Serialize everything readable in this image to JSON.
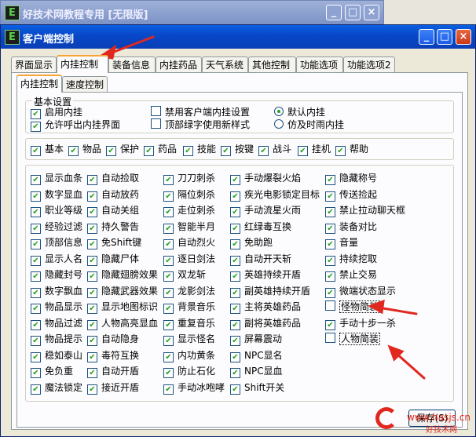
{
  "background_window": {
    "title": "好技术网教程专用 [无限版]"
  },
  "main_window": {
    "title": "客户端控制"
  },
  "title_buttons": {
    "minimize": "_",
    "maximize": "□",
    "close": "×"
  },
  "app_icon_letter": "E",
  "tabs": [
    "界面显示",
    "内挂控制",
    "装备信息",
    "内挂药品",
    "天气系统",
    "其他控制",
    "功能选项",
    "功能选项2"
  ],
  "subtabs": [
    "内挂控制",
    "速度控制"
  ],
  "basic_settings": {
    "title": "基本设置",
    "options": [
      {
        "label": "启用内挂",
        "type": "checkbox",
        "checked": true
      },
      {
        "label": "禁用客户端内挂设置",
        "type": "checkbox",
        "checked": false
      },
      {
        "label": "默认内挂",
        "type": "radio",
        "checked": true
      },
      {
        "label": "允许呼出内挂界面",
        "type": "checkbox",
        "checked": true
      },
      {
        "label": "顶部绿字使用新样式",
        "type": "checkbox",
        "checked": false
      },
      {
        "label": "仿及时雨内挂",
        "type": "radio",
        "checked": false
      }
    ]
  },
  "categories": [
    "基本",
    "物品",
    "保护",
    "药品",
    "技能",
    "按键",
    "战斗",
    "挂机",
    "帮助"
  ],
  "features": {
    "col1": [
      "显示血条",
      "数字显血",
      "职业等级",
      "经验过滤",
      "顶部信息",
      "显示人名",
      "隐藏封号",
      "数字飘血",
      "物品显示",
      "物品过滤",
      "物品提示",
      "稳如泰山",
      "免负重",
      "魔法锁定"
    ],
    "col2": [
      "自动捡取",
      "自动放药",
      "自动关组",
      "持久警告",
      "免Shift键",
      "隐藏尸体",
      "隐藏翅膀效果",
      "隐藏武器效果",
      "显示地图标识",
      "人物高亮显血",
      "自动隐身",
      "毒符互换",
      "自动开盾",
      "接近开盾"
    ],
    "col3": [
      "刀刀刺杀",
      "隔位刺杀",
      "走位刺杀",
      "智能半月",
      "自动烈火",
      "逐日剑法",
      "双龙斩",
      "龙影剑法",
      "背景音乐",
      "重复音乐",
      "显示怪名",
      "内功黄条",
      "防止石化",
      "手动冰咆哮"
    ],
    "col4": [
      "手动爆裂火焰",
      "疾光电影锁定目标",
      "手动流星火雨",
      "红绿毒互换",
      "免助跑",
      "自动开天斩",
      "英雄持续开盾",
      "副英雄持续开盾",
      "主将英雄药品",
      "副将英雄药品",
      "屏幕震动",
      "NPC显名",
      "NPC显血",
      "Shift开关"
    ],
    "col5": [
      "隐藏称号",
      "传送捡起",
      "禁止拉动聊天框",
      "装备对比",
      "音量",
      "持续挖取",
      "禁止交易",
      "微端状态显示",
      "怪物简装",
      "手动十步一杀",
      "人物简装"
    ]
  },
  "unchecked_features": [
    "怪物简装",
    "人物简装"
  ],
  "check_mark": "✔",
  "save_button": "保存(S)",
  "watermark": {
    "url": "www.hasjs.cn",
    "sub": "好技术网"
  },
  "colors": {
    "title_blue": "#0747c7",
    "tab_highlight": "#f6a234",
    "check_green": "#21a121",
    "arrow_red": "#e0281f"
  }
}
